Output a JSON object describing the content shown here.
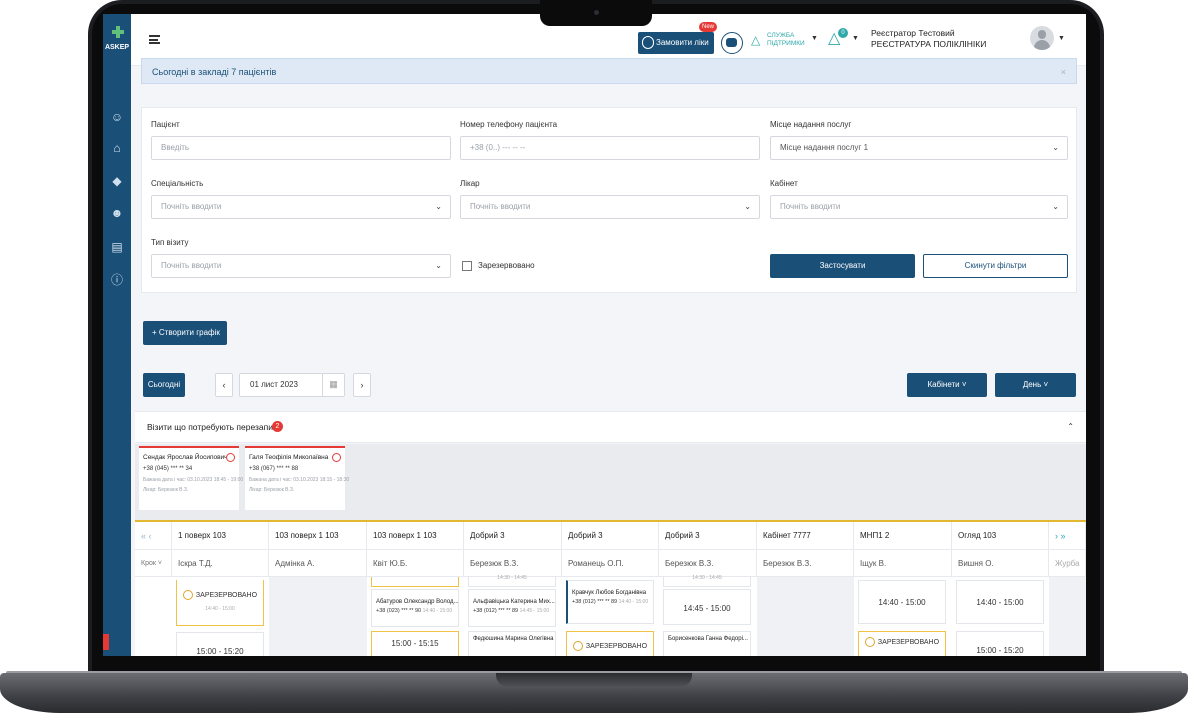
{
  "app": {
    "logo_text": "ASKEP"
  },
  "topbar": {
    "order_button": "Замовити ліки",
    "new_badge": "New",
    "support_text": "СЛУЖБА ПІДТРИМКИ",
    "bell_count": "0",
    "user_role": "Реєстратор Тестовий РЕЄСТРАТУРА ПОЛІКЛІНІКИ"
  },
  "notice": {
    "text": "Сьогодні в закладі 7 пацієнтів",
    "close": "×"
  },
  "filters": {
    "patient_label": "Пацієнт",
    "patient_placeholder": "Введіть",
    "phone_label": "Номер телефону пацієнта",
    "phone_placeholder": "+38 (0..) --- -- --",
    "place_label": "Місце надання послуг",
    "place_value": "Місце надання послуг 1",
    "specialty_label": "Спеціальність",
    "specialty_placeholder": "Почніть вводити",
    "doctor_label": "Лікар",
    "doctor_placeholder": "Почніть вводити",
    "cabinet_label": "Кабінет",
    "cabinet_placeholder": "Почніть вводити",
    "visit_type_label": "Тип візиту",
    "visit_type_placeholder": "Почніть вводити",
    "reserved_label": "Зарезервовано",
    "apply_button": "Застосувати",
    "reset_button": "Скинути фільтри"
  },
  "toolbar": {
    "create_button": "+ Створити графік",
    "today_button": "Сьогодні",
    "prev": "‹",
    "next": "›",
    "date": "01 лист 2023",
    "cabinets_button": "Кабінети ˅",
    "day_button": "День ˅"
  },
  "reschedule": {
    "title": "Візити що потребують перезапису",
    "count": "2",
    "cards": [
      {
        "name": "Сендак Ярослав Йосипович",
        "phone": "+38 (045) *** ** 34",
        "date": "Бажана дата і час: 03.10.2023 18:45 - 19:00",
        "doctor": "Лікар: Березюк В.З."
      },
      {
        "name": "Галя Теофілія Миколаївна",
        "phone": "+38 (067) *** ** 88",
        "date": "Бажана дата і час: 03.10.2023 18:15 - 18:30",
        "doctor": "Лікар: Березюк В.З."
      }
    ]
  },
  "schedule": {
    "columns": [
      {
        "room": "1 поверх 103",
        "doctor": "Іскра Т.Д."
      },
      {
        "room": "103 поверх 1 103",
        "doctor": "Адмінка А."
      },
      {
        "room": "103 поверх 1 103",
        "doctor": "Квіт Ю.Б."
      },
      {
        "room": "Добрий 3",
        "doctor": "Березюк В.З."
      },
      {
        "room": "Добрий 3",
        "doctor": "Романець О.П."
      },
      {
        "room": "Добрий 3",
        "doctor": "Березюк В.З."
      },
      {
        "room": "Кабінет 7777",
        "doctor": "Березюк В.З."
      },
      {
        "room": "МНП1 2",
        "doctor": "Іщук В."
      },
      {
        "room": "Огляд 103",
        "doctor": "Вишня О."
      },
      {
        "room": "",
        "doctor": "Журба"
      }
    ],
    "step_label": "Крок ˅",
    "reserved": "ЗАРЕЗЕРВОВАНО",
    "time_1440_1500": "14:40 - 15:00",
    "time_1445_1500": "14:45 - 15:00",
    "time_1500_1515": "15:00 - 15:15",
    "time_1500_1520": "15:00 - 15:20",
    "time_1430_1445": "14:30 - 14:45",
    "slots": {
      "abaturov_name": "Абатуров Олександр Волод...",
      "abaturov_phone": "+38 (023) *** ** 90",
      "alfavitska_name": "Альфавіцька Катерина Мих...",
      "alfavitska_phone": "+38 (012) *** ** 89",
      "kravchuk_name": "Кравчук Любов Богданівна",
      "kravchuk_phone": "+38 (012) *** ** 89",
      "fedyushina_name": "Федюшина Марина Олегівна",
      "borysenkova_name": "Борисенкова Ганна Федорі..."
    }
  }
}
